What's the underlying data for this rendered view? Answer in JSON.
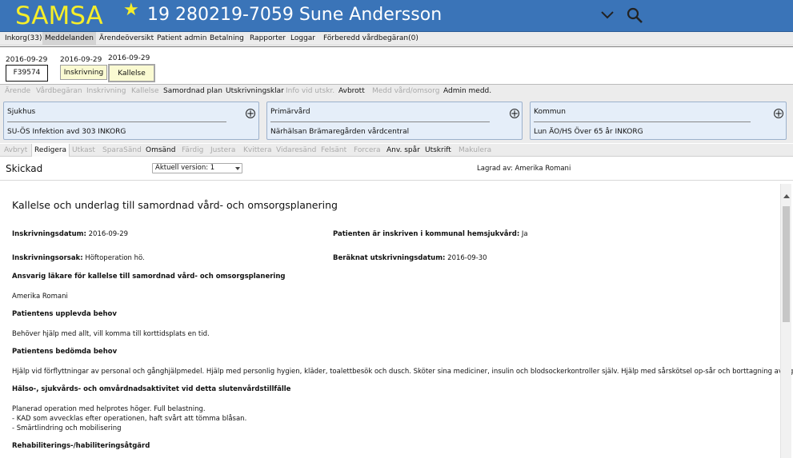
{
  "header": {
    "logo": "SAMSA",
    "patient": "19 280219-7059 Sune Andersson",
    "colors": {
      "bar": "#3a74b8",
      "logo": "#f6ee2a"
    }
  },
  "menu": [
    "Inkorg(33)",
    "Meddelanden",
    "Ärendeöversikt",
    "Patient admin",
    "Betalning",
    "Rapporter",
    "Loggar",
    "Förberedd vårdbegäran(0)"
  ],
  "case": {
    "items": [
      {
        "date": "2016-09-29",
        "label": "F39574"
      },
      {
        "date": "2016-09-29",
        "label": "Inskrivning"
      },
      {
        "date": "2016-09-29",
        "label": "Kallelse"
      }
    ]
  },
  "actions1": [
    "Ärende",
    "Vårdbegäran",
    "Inskrivning",
    "Kallelse",
    "Samordnad plan",
    "Utskrivningsklar",
    "Info vid utskr.",
    "Avbrott",
    "Medd vård/omsorg",
    "Admin medd."
  ],
  "cards": [
    {
      "title": "Sjukhus",
      "value": "SU-ÖS Infektion avd 303 INKORG"
    },
    {
      "title": "Primärvård",
      "value": "Närhälsan Brämaregården vårdcentral"
    },
    {
      "title": "Kommun",
      "value": "Lun ÄO/HS Över 65 år INKORG"
    }
  ],
  "actions2": [
    "Avbryt",
    "Redigera",
    "Utkast",
    "SparaSänd",
    "Omsänd",
    "Färdig",
    "Justera",
    "Kvittera",
    "Vidaresänd",
    "Felsänt",
    "Forcera",
    "Anv. spår",
    "Utskrift",
    "Makulera"
  ],
  "status": {
    "state": "Skickad",
    "version": "Aktuell version: 1",
    "saved": "Lagrad av: Amerika Romani"
  },
  "doc": {
    "title": "Kallelse och underlag till samordnad vård- och omsorgsplanering",
    "f1_label": "Inskrivningsdatum:",
    "f1_value": "2016-09-29",
    "f2_label": "Patienten är inskriven i kommunal hemsjukvård:",
    "f2_value": "Ja",
    "f3_label": "Inskrivningsorsak:",
    "f3_value": "Höftoperation hö.",
    "f4_label": "Beräknat utskrivningsdatum:",
    "f4_value": "2016-09-30",
    "h1": "Ansvarig läkare för kallelse till samordnad vård- och omsorgsplanering",
    "t1": "Amerika Romani",
    "h2": "Patientens upplevda behov",
    "t2": "Behöver hjälp med allt, vill komma till korttidsplats en tid.",
    "h3": "Patientens bedömda behov",
    "t3": "Hjälp vid förflyttningar av personal och gånghjälpmedel. Hjälp med personlig hygien, kläder, toalettbesök och dusch. Sköter sina mediciner, insulin och blodsockerkontroller själv. Hjälp med sårskötsel op-sår och borttagning av agraffer.",
    "h4": "Hälso-, sjukvårds- och omvårdnadsaktivitet vid detta slutenvårdstillfälle",
    "t4": "Planerad operation med helprotes höger. Full belastning.\n- KAD som avvecklas efter operationen, haft svårt att tömma blåsan.\n- Smärtlindring och mobilisering",
    "h5": "Rehabiliterings-/habiliteringsåtgärd"
  }
}
